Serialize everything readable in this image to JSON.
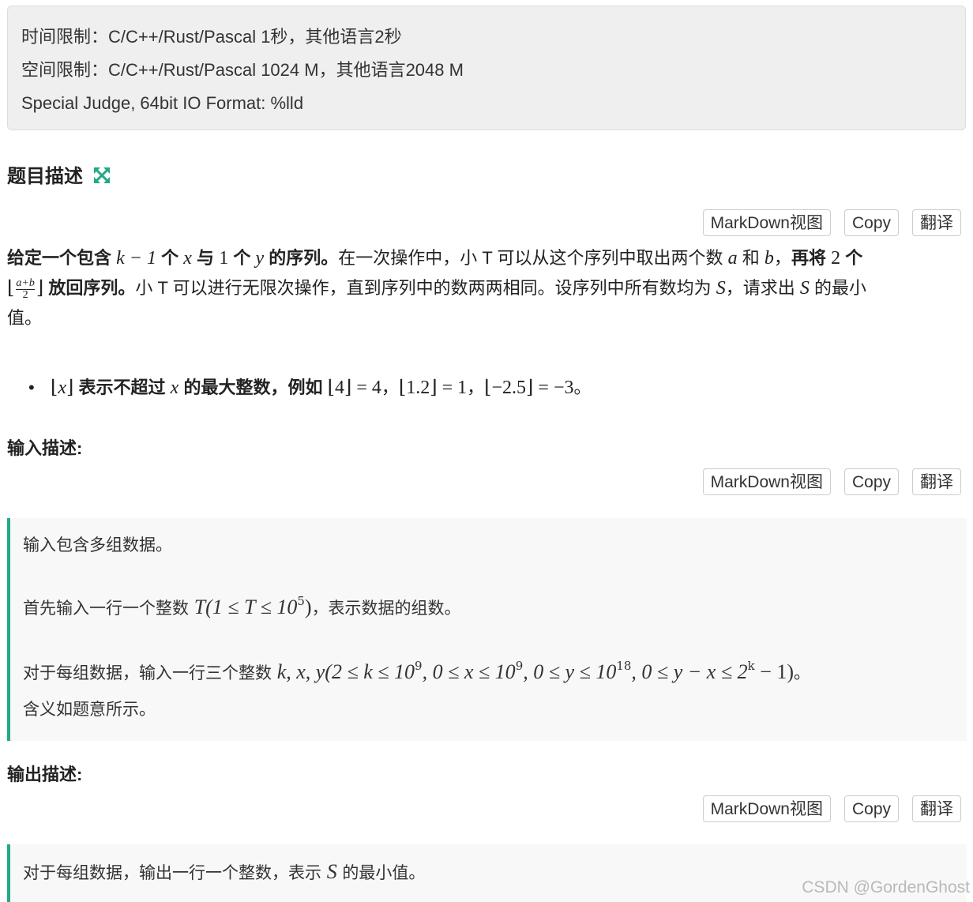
{
  "limits": {
    "time": "时间限制：C/C++/Rust/Pascal 1秒，其他语言2秒",
    "memory": "空间限制：C/C++/Rust/Pascal 1024 M，其他语言2048 M",
    "judge": "Special Judge, 64bit IO Format: %lld"
  },
  "buttons": {
    "markdown": "MarkDown视图",
    "copy": "Copy",
    "translate": "翻译"
  },
  "sections": {
    "description_title": "题目描述",
    "input_title": "输入描述:",
    "output_title": "输出描述:"
  },
  "description": {
    "p1": "给定一个包含",
    "m1": "k − 1",
    "p2": "个",
    "m2": "x",
    "p3": "与",
    "m3": "1",
    "p4": "个",
    "m4": "y",
    "p5": "的序列。",
    "p6": "在一次操作中，小 T 可以从这个序列中取出两个数",
    "m5": "a",
    "p7": "和",
    "m6": "b",
    "p8": "，",
    "p9": "再将",
    "m7": "2",
    "p10": "个",
    "frac_top": "a+b",
    "frac_bottom": "2",
    "p11": "放回序列。",
    "p12": "小 T 可以进行无限次操作，直到序列中的数两两相同。设序列中所有数均为",
    "m8": "S",
    "p13": "，请求出",
    "m9": "S",
    "p14": "的最小",
    "p15": "值。"
  },
  "bullet": {
    "m1": "x",
    "t1": "表示不超过",
    "m2": "x",
    "t2": "的最大整数，例如",
    "ex1": "⌊4⌋ = 4",
    "ex2": "⌊1.2⌋ = 1",
    "ex3": "⌊−2.5⌋ = −3",
    "sep": "，",
    "end": "。"
  },
  "input": {
    "line1": "输入包含多组数据。",
    "line2_pre": "首先输入一行一个整数",
    "line2_math": "T(1 ≤ T ≤ 10",
    "line2_sup": "5",
    "line2_close": ")",
    "line2_post": "，表示数据的组数。",
    "line3_pre": "对于每组数据，输入一行三个整数",
    "line3_math_a": "k, x, y(2 ≤ k ≤ 10",
    "sup_a": "9",
    "line3_math_b": ", 0 ≤ x ≤ 10",
    "sup_b": "9",
    "line3_math_c": ", 0 ≤ y ≤ 10",
    "sup_c": "18",
    "line3_math_d": ", 0 ≤ y − x ≤ 2",
    "sup_d": "k",
    "line3_math_e": " − 1)",
    "line3_post": "。",
    "line4": "含义如题意所示。"
  },
  "output": {
    "pre": "对于每组数据，输出一行一个整数，表示",
    "math": "S",
    "post": "的最小值。"
  },
  "watermark": "CSDN @GordenGhost",
  "colors": {
    "accent": "#22a986",
    "panel": "#efefef",
    "block": "#f8f8f8"
  }
}
